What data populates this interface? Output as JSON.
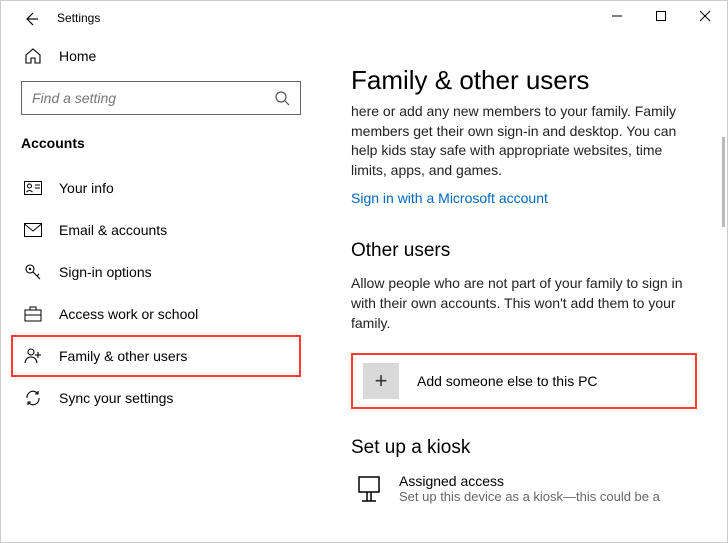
{
  "window": {
    "title": "Settings"
  },
  "sidebar": {
    "home_label": "Home",
    "search_placeholder": "Find a setting",
    "section_header": "Accounts",
    "items": [
      {
        "label": "Your info"
      },
      {
        "label": "Email & accounts"
      },
      {
        "label": "Sign-in options"
      },
      {
        "label": "Access work or school"
      },
      {
        "label": "Family & other users"
      },
      {
        "label": "Sync your settings"
      }
    ]
  },
  "main": {
    "page_title": "Family & other users",
    "family_description": "here or add any new members to your family. Family members get their own sign-in and desktop. You can help kids stay safe with appropriate websites, time limits, apps, and games.",
    "signin_link": "Sign in with a Microsoft account",
    "other_users_title": "Other users",
    "other_users_desc": "Allow people who are not part of your family to sign in with their own accounts. This won't add them to your family.",
    "add_someone_label": "Add someone else to this PC",
    "kiosk_title": "Set up a kiosk",
    "assigned_access_title": "Assigned access",
    "assigned_access_sub": "Set up this device as a kiosk—this could be a"
  }
}
